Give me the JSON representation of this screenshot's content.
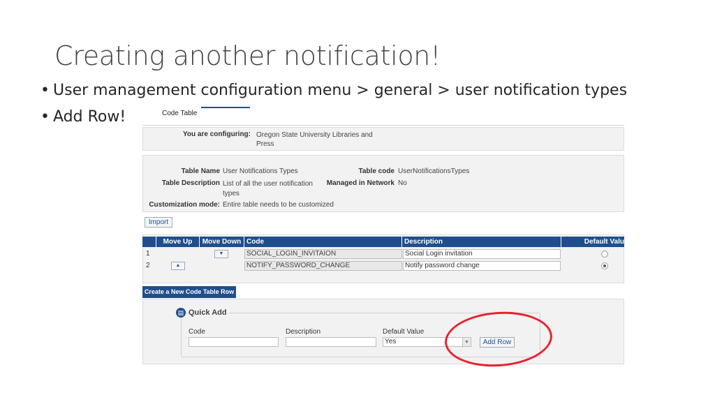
{
  "slide": {
    "title": "Creating another notification!",
    "bullets": [
      "User management configuration menu > general > user notification types",
      "Add Row!"
    ],
    "bullet_glyph": "•"
  },
  "screenshot": {
    "tab_label": "Code Table",
    "configuring": {
      "label": "You are configuring:",
      "value": "Oregon State University Libraries and Press"
    },
    "details": {
      "table_name_label": "Table Name",
      "table_name_value": "User Notifications Types",
      "table_description_label": "Table Description",
      "table_description_value": "List of all the user notification types",
      "customization_mode_label": "Customization mode:",
      "customization_mode_value": "Entire table needs to be customized",
      "table_code_label": "Table code",
      "table_code_value": "UserNotificationsTypes",
      "managed_in_network_label": "Managed in Network",
      "managed_in_network_value": "No"
    },
    "import_label": "Import",
    "table": {
      "headers": [
        "Move Up",
        "Move Down",
        "Code",
        "Description",
        "Default Valu"
      ],
      "rows": [
        {
          "index": "1",
          "code": "SOCIAL_LOGIN_INVITAION",
          "description": "Social Login invitation",
          "default_selected": false
        },
        {
          "index": "2",
          "code": "NOTIFY_PASSWORD_CHANGE",
          "description": "Notify password change",
          "default_selected": true
        }
      ]
    },
    "create_button_label": "Create a New Code Table Row",
    "quick_add": {
      "title": "Quick Add",
      "code_label": "Code",
      "code_value": "",
      "description_label": "Description",
      "description_value": "",
      "default_value_label": "Default Value",
      "default_value_selected": "Yes",
      "add_row_label": "Add Row"
    }
  },
  "colors": {
    "header_blue": "#1f4e8c",
    "highlight_circle": "#e8212e",
    "panel_bg": "#f2f2f2"
  }
}
